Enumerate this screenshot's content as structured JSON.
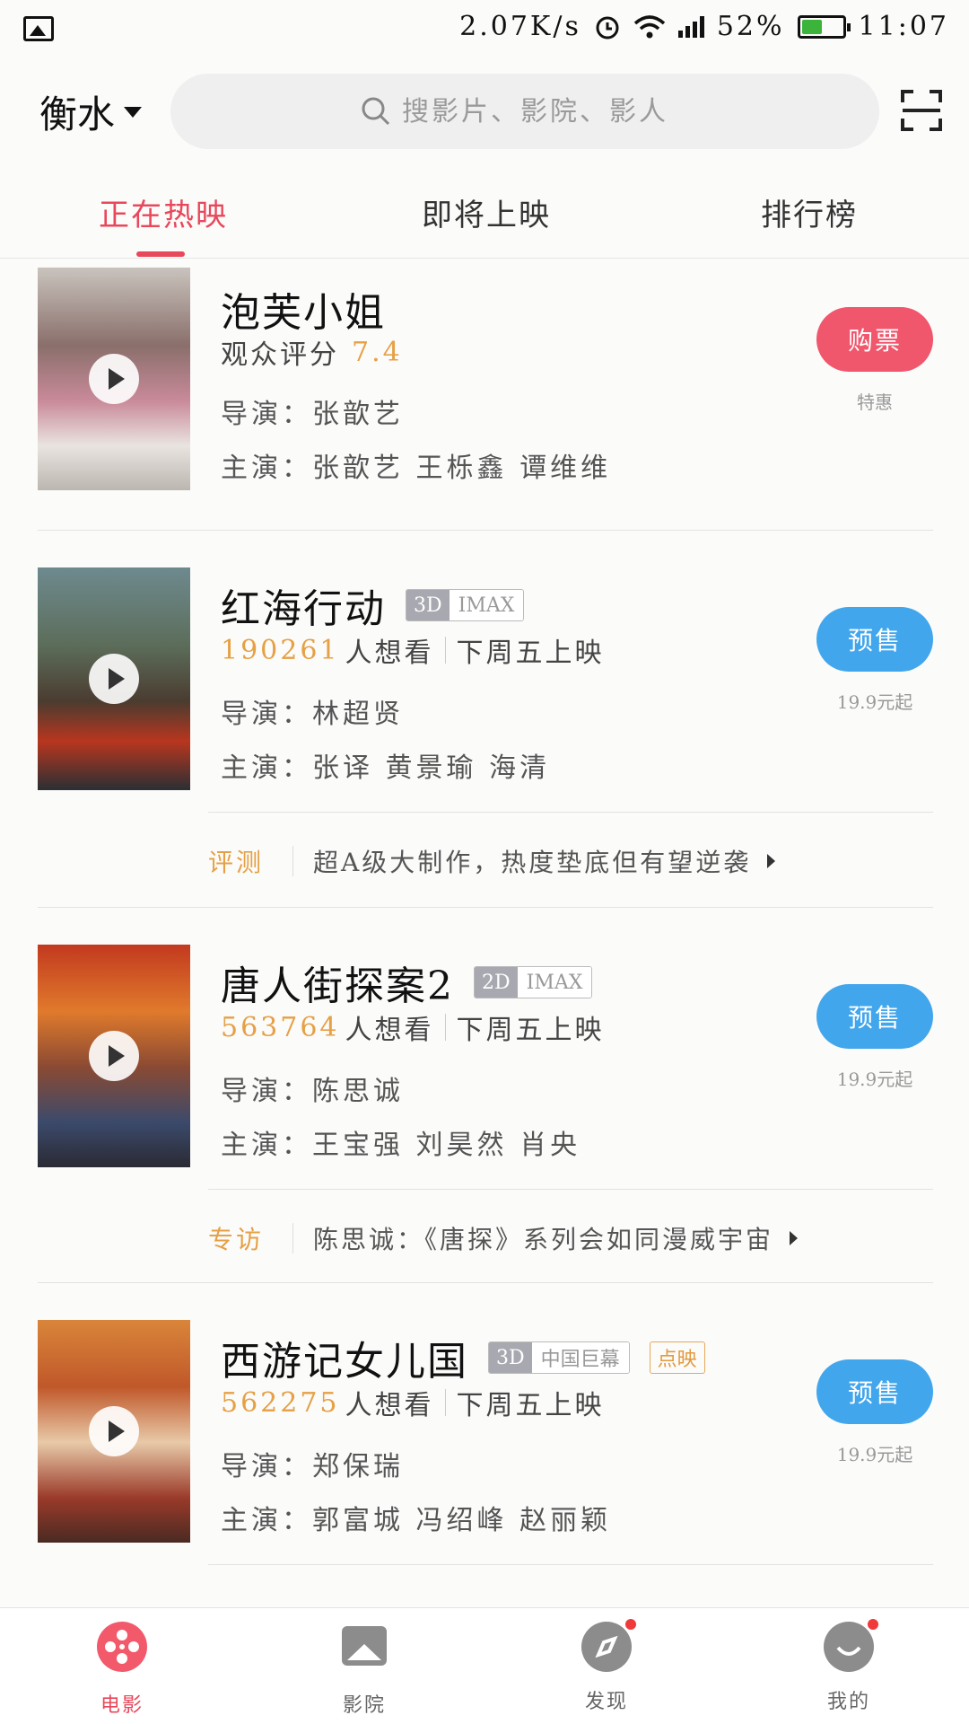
{
  "status_bar": {
    "speed": "2.07K/s",
    "battery": "52%",
    "battery_level": 0.52,
    "time": "11:07"
  },
  "header": {
    "city": "衡水",
    "search_placeholder": "搜影片、影院、影人"
  },
  "tabs": [
    "正在热映",
    "即将上映",
    "排行榜"
  ],
  "movies": [
    {
      "title": "泡芙小姐",
      "score_label": "观众评分",
      "score": "7.4",
      "director": "导演：张歆艺",
      "cast": "主演：张歆艺 王栎鑫 谭维维",
      "button": "购票",
      "button_note": "特惠"
    },
    {
      "title": "红海行动",
      "badge_dim": "3D",
      "badge_fmt": "IMAX",
      "want_count": "190261",
      "want_label": "人想看",
      "release": "下周五上映",
      "director": "导演：林超贤",
      "cast": "主演：张译 黄景瑜 海清",
      "button": "预售",
      "button_note": "19.9元起",
      "review_tag": "评测",
      "review_text": "超A级大制作，热度垫底但有望逆袭"
    },
    {
      "title": "唐人街探案2",
      "badge_dim": "2D",
      "badge_fmt": "IMAX",
      "want_count": "563764",
      "want_label": "人想看",
      "release": "下周五上映",
      "director": "导演：陈思诚",
      "cast": "主演：王宝强 刘昊然 肖央",
      "button": "预售",
      "button_note": "19.9元起",
      "review_tag": "专访",
      "review_text": "陈思诚：《唐探》系列会如同漫威宇宙"
    },
    {
      "title": "西游记女儿国",
      "badge_dim": "3D",
      "badge_fmt": "中国巨幕",
      "badge_extra": "点映",
      "want_count": "562275",
      "want_label": "人想看",
      "release": "下周五上映",
      "director": "导演：郑保瑞",
      "cast": "主演：郭富城 冯绍峰 赵丽颖",
      "button": "预售",
      "button_note": "19.9元起"
    }
  ],
  "bottom_nav": [
    "电影",
    "影院",
    "发现",
    "我的"
  ],
  "colors": {
    "accent_red": "#e8485b",
    "presale_blue": "#42a6ec",
    "want_orange": "#e6a045"
  }
}
